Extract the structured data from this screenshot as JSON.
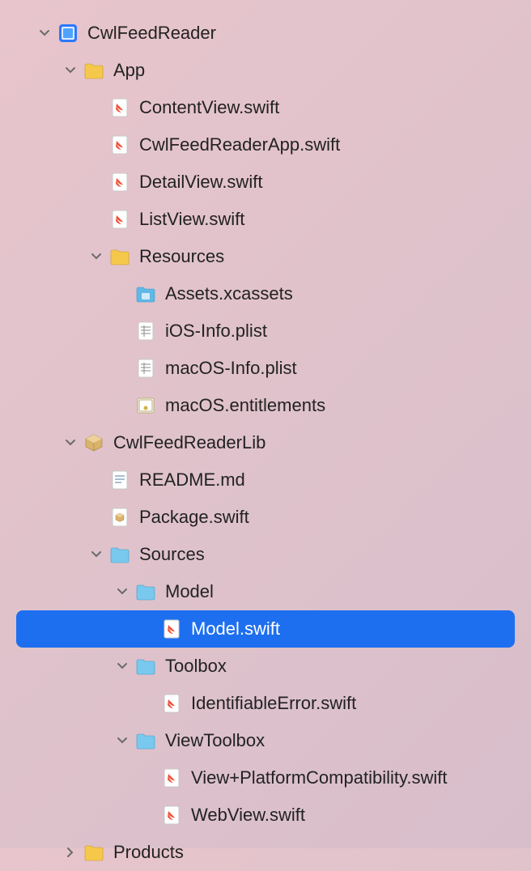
{
  "selection_color": "#1e6fef",
  "tree": [
    {
      "id": "project",
      "depth": 0,
      "expanded": true,
      "icon": "xcode-project",
      "label": "CwlFeedReader"
    },
    {
      "id": "app-folder",
      "depth": 1,
      "expanded": true,
      "icon": "folder-yellow",
      "label": "App"
    },
    {
      "id": "contentview",
      "depth": 2,
      "icon": "swift",
      "label": "ContentView.swift"
    },
    {
      "id": "appfile",
      "depth": 2,
      "icon": "swift",
      "label": "CwlFeedReaderApp.swift"
    },
    {
      "id": "detailview",
      "depth": 2,
      "icon": "swift",
      "label": "DetailView.swift"
    },
    {
      "id": "listview",
      "depth": 2,
      "icon": "swift",
      "label": "ListView.swift"
    },
    {
      "id": "resources-folder",
      "depth": 2,
      "expanded": true,
      "icon": "folder-yellow",
      "label": "Resources"
    },
    {
      "id": "assets",
      "depth": 3,
      "icon": "assets",
      "label": "Assets.xcassets"
    },
    {
      "id": "ios-info",
      "depth": 3,
      "icon": "plist",
      "label": "iOS-Info.plist"
    },
    {
      "id": "macos-info",
      "depth": 3,
      "icon": "plist",
      "label": "macOS-Info.plist"
    },
    {
      "id": "entitlements",
      "depth": 3,
      "icon": "entitlements",
      "label": "macOS.entitlements"
    },
    {
      "id": "lib-package",
      "depth": 1,
      "expanded": true,
      "icon": "package",
      "label": "CwlFeedReaderLib"
    },
    {
      "id": "readme",
      "depth": 2,
      "icon": "text-file",
      "label": "README.md"
    },
    {
      "id": "package-swift",
      "depth": 2,
      "icon": "package-file",
      "label": "Package.swift"
    },
    {
      "id": "sources-folder",
      "depth": 2,
      "expanded": true,
      "icon": "folder-blue",
      "label": "Sources"
    },
    {
      "id": "model-folder",
      "depth": 3,
      "expanded": true,
      "icon": "folder-blue",
      "label": "Model"
    },
    {
      "id": "model-swift",
      "depth": 4,
      "icon": "swift",
      "label": "Model.swift",
      "selected": true
    },
    {
      "id": "toolbox-folder",
      "depth": 3,
      "expanded": true,
      "icon": "folder-blue",
      "label": "Toolbox"
    },
    {
      "id": "identifiable-error",
      "depth": 4,
      "icon": "swift",
      "label": "IdentifiableError.swift"
    },
    {
      "id": "viewtoolbox-folder",
      "depth": 3,
      "expanded": true,
      "icon": "folder-blue",
      "label": "ViewToolbox"
    },
    {
      "id": "view-compat",
      "depth": 4,
      "icon": "swift",
      "label": "View+PlatformCompatibility.swift"
    },
    {
      "id": "webview",
      "depth": 4,
      "icon": "swift",
      "label": "WebView.swift"
    },
    {
      "id": "products-folder",
      "depth": 1,
      "expanded": false,
      "icon": "folder-yellow",
      "label": "Products"
    }
  ]
}
